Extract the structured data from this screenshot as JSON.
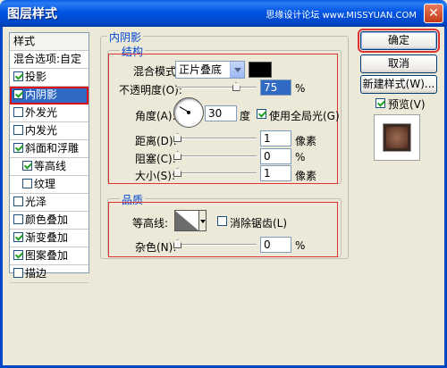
{
  "window": {
    "title": "图层样式",
    "watermark": "思缘设计论坛 www.MISSYUAN.COM",
    "close_symbol": "✕"
  },
  "styles_list": {
    "header": "样式",
    "items": [
      {
        "label": "混合选项:自定",
        "checkbox": false,
        "checked": false,
        "selected": false
      },
      {
        "label": "投影",
        "checkbox": true,
        "checked": true,
        "selected": false
      },
      {
        "label": "内阴影",
        "checkbox": true,
        "checked": true,
        "selected": true
      },
      {
        "label": "外发光",
        "checkbox": true,
        "checked": false,
        "selected": false
      },
      {
        "label": "内发光",
        "checkbox": true,
        "checked": false,
        "selected": false
      },
      {
        "label": "斜面和浮雕",
        "checkbox": true,
        "checked": true,
        "selected": false
      },
      {
        "label": "等高线",
        "checkbox": true,
        "checked": true,
        "selected": false,
        "indent": true
      },
      {
        "label": "纹理",
        "checkbox": true,
        "checked": false,
        "selected": false,
        "indent": true
      },
      {
        "label": "光泽",
        "checkbox": true,
        "checked": false,
        "selected": false
      },
      {
        "label": "颜色叠加",
        "checkbox": true,
        "checked": false,
        "selected": false
      },
      {
        "label": "渐变叠加",
        "checkbox": true,
        "checked": true,
        "selected": false
      },
      {
        "label": "图案叠加",
        "checkbox": true,
        "checked": true,
        "selected": false
      },
      {
        "label": "描边",
        "checkbox": true,
        "checked": false,
        "selected": false
      }
    ]
  },
  "panel": {
    "title": "内阴影",
    "structure": {
      "legend": "结构",
      "blend_mode_label": "混合模式:",
      "blend_mode_value": "正片叠底",
      "shadow_color": "#000000",
      "opacity_label": "不透明度(O):",
      "opacity_value": "75",
      "opacity_unit": "%",
      "opacity_level": 0.75,
      "angle_label": "角度(A):",
      "angle_value": "30",
      "angle_unit": "度",
      "global_light_label": "使用全局光(G)",
      "global_light_checked": true,
      "distance_label": "距离(D):",
      "distance_value": "1",
      "distance_unit": "像素",
      "choke_label": "阻塞(C):",
      "choke_value": "0",
      "choke_unit": "%",
      "size_label": "大小(S):",
      "size_value": "1",
      "size_unit": "像素"
    },
    "quality": {
      "legend": "品质",
      "contour_label": "等高线:",
      "anti_alias_label": "消除锯齿(L)",
      "anti_alias_checked": false,
      "noise_label": "杂色(N):",
      "noise_value": "0",
      "noise_unit": "%"
    }
  },
  "buttons": {
    "ok": "确定",
    "cancel": "取消",
    "new_style": "新建样式(W)...",
    "preview_label": "预览(V)",
    "preview_checked": true
  }
}
